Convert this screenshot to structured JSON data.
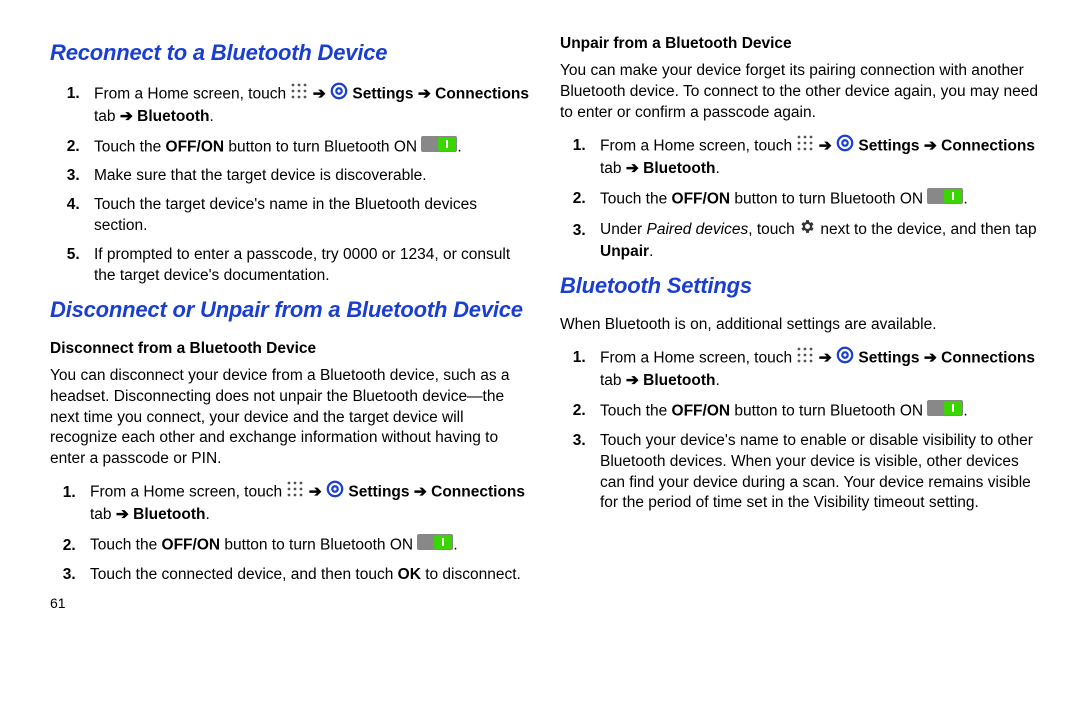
{
  "page_number": "61",
  "arrow": "➔",
  "nav": {
    "prefix": "From a Home screen, touch ",
    "settings": "Settings",
    "conn_tab": "Connections",
    "tab_word": " tab ",
    "bt": "Bluetooth",
    "period": "."
  },
  "toggle": {
    "p1": "Touch the ",
    "offon": "OFF/ON",
    "p2": " button to turn Bluetooth ON ",
    "p3": "."
  },
  "left": {
    "h1": "Reconnect to a Bluetooth Device",
    "reconnect": {
      "s3": "Make sure that the target device is discoverable.",
      "s4": "Touch the target device's name in the Bluetooth devices section.",
      "s5": "If prompted to enter a passcode, try 0000 or 1234, or consult the target device's documentation."
    },
    "h2": "Disconnect or Unpair from a Bluetooth Device",
    "disc_sub": "Disconnect from a Bluetooth Device",
    "disc_intro": "You can disconnect your device from a Bluetooth device, such as a headset. Disconnecting does not unpair the Bluetooth device—the next time you connect, your device and the target device will recognize each other and exchange information without having to enter a passcode or PIN.",
    "disc_s3a": "Touch the connected device, and then touch ",
    "disc_ok": "OK",
    "disc_s3b": " to disconnect."
  },
  "right": {
    "unpair_sub": "Unpair from a Bluetooth Device",
    "unpair_intro": "You can make your device forget its pairing connection with another Bluetooth device. To connect to the other device again, you may need to enter or confirm a passcode again.",
    "unpair_s3a": "Under ",
    "paired": "Paired devices",
    "unpair_s3b": ", touch ",
    "unpair_s3c": " next to the device, and then tap ",
    "unpair_label": "Unpair",
    "h3": "Bluetooth Settings",
    "bts_intro": "When Bluetooth is on, additional settings are available.",
    "bts_s3": "Touch your device's name to enable or disable visibility to other Bluetooth devices. When your device is visible, other devices can find your device during a scan. Your device remains visible for the period of time set in the Visibility timeout setting."
  }
}
